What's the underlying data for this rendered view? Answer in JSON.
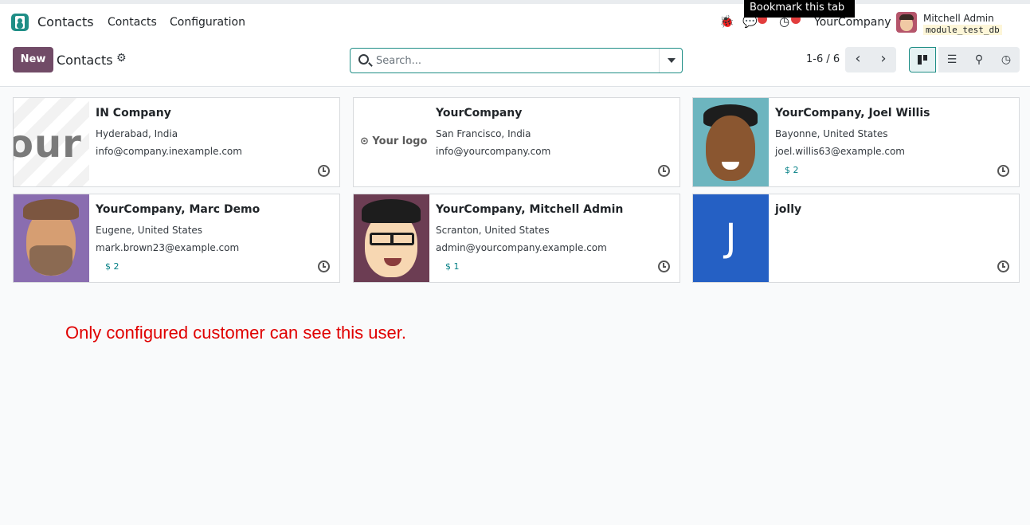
{
  "app": {
    "brand": "Contacts",
    "menu": [
      "Contacts",
      "Configuration"
    ],
    "company": "YourCompany",
    "user_name": "Mitchell Admin",
    "db_name": "module_test_db",
    "tooltip": "Bookmark this tab"
  },
  "icons": {
    "bug": "bug-icon",
    "chat": "chat-icon",
    "activity": "clock-icon",
    "gear": "gear-icon",
    "search": "search-icon",
    "prev": "‹",
    "next": "›",
    "list": "☰",
    "map": "map-marker-icon",
    "activity_view": "clock-icon"
  },
  "control": {
    "new_label": "New",
    "title": "Contacts",
    "search_placeholder": "Search...",
    "pager": "1-6 / 6"
  },
  "cards": [
    {
      "name": "IN Company",
      "location": "Hyderabad, India",
      "email": "info@company.inexample.com",
      "stat": "",
      "image_text": "our"
    },
    {
      "name": "YourCompany",
      "location": "San Francisco, India",
      "email": "info@yourcompany.com",
      "stat": "",
      "image_text": "⊙ Your logo"
    },
    {
      "name": "YourCompany, Joel Willis",
      "location": "Bayonne, United States",
      "email": "joel.willis63@example.com",
      "stat": "$ 2"
    },
    {
      "name": "YourCompany, Marc Demo",
      "location": "Eugene, United States",
      "email": "mark.brown23@example.com",
      "stat": "$ 2"
    },
    {
      "name": "YourCompany, Mitchell Admin",
      "location": "Scranton, United States",
      "email": "admin@yourcompany.example.com",
      "stat": "$ 1"
    },
    {
      "name": "jolly",
      "location": "",
      "email": "",
      "stat": "",
      "image_text": "J"
    }
  ],
  "note": "Only configured customer can see this user.",
  "colors": {
    "primary": "#714b67",
    "accent": "#1f8e86",
    "note": "#e00000",
    "avatar_j": "#2560c4"
  }
}
